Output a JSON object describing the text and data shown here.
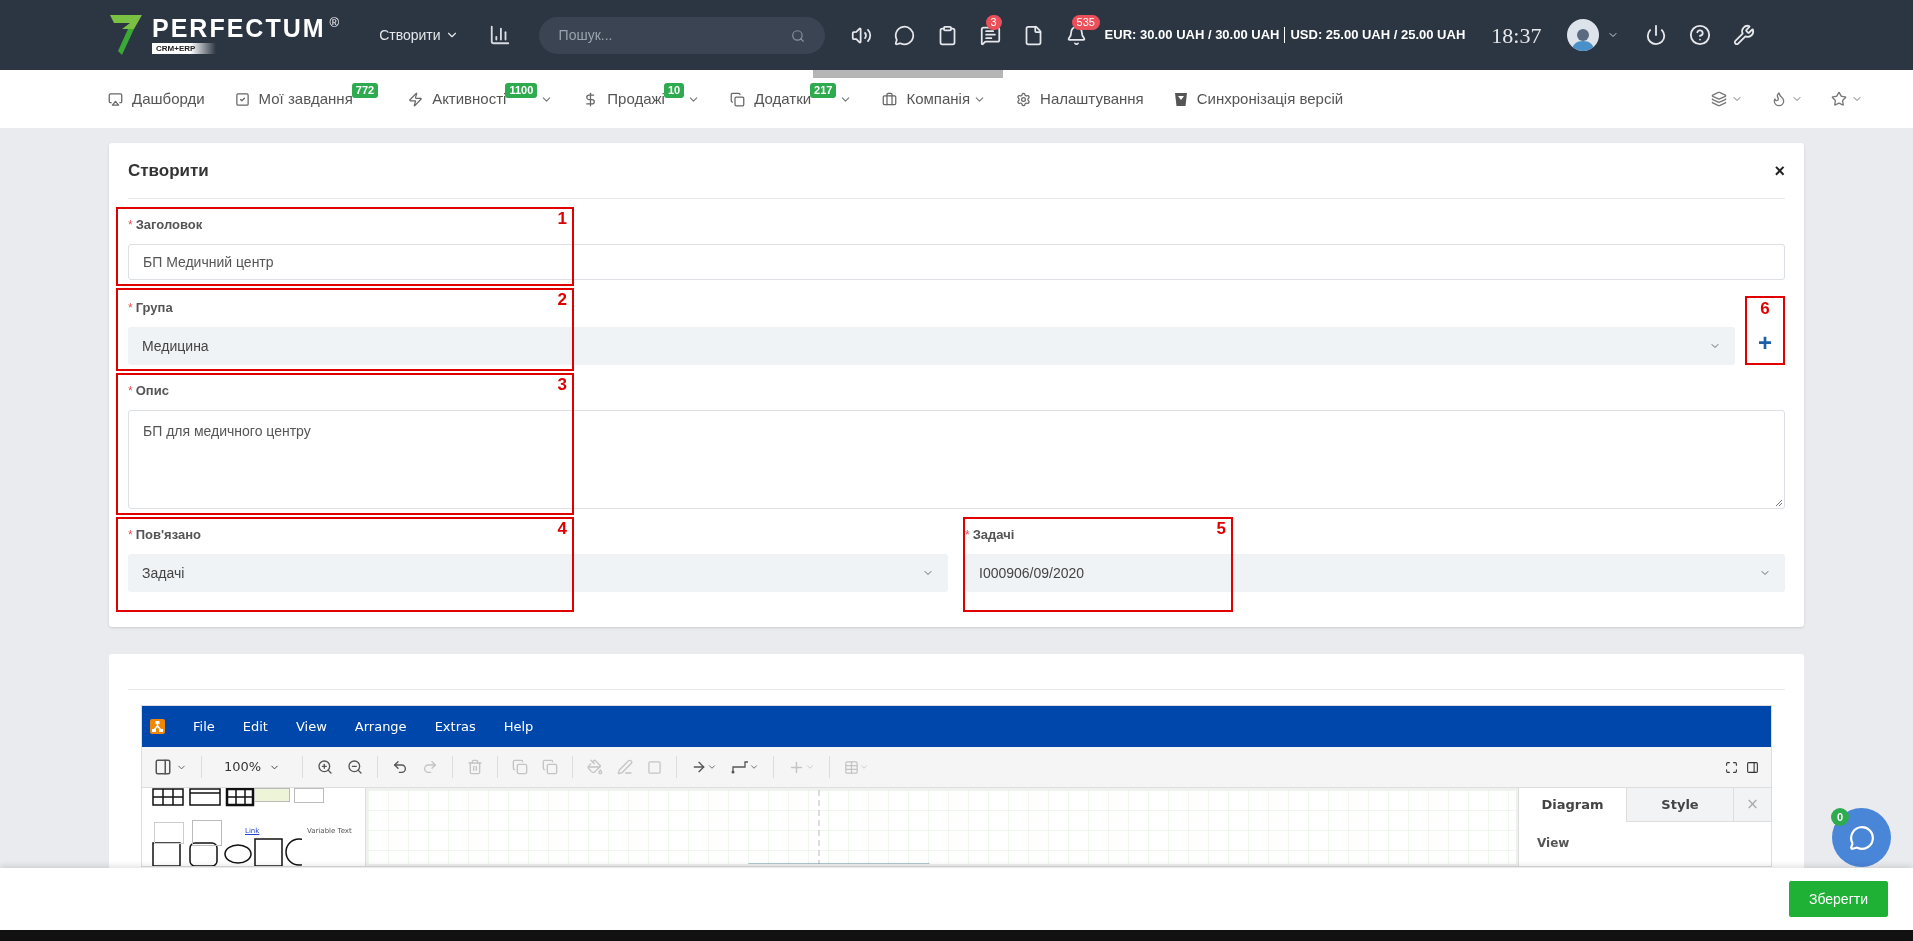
{
  "header": {
    "logo": "PERFECTUM",
    "logo_mark": "®",
    "logo_sub": "CRM+ERP",
    "create_menu": "Створити",
    "search": {
      "placeholder": "Пошук..."
    },
    "icons": [
      {
        "kind": "sound"
      },
      {
        "kind": "chat"
      },
      {
        "kind": "clipboard"
      },
      {
        "kind": "messages",
        "badge": "3"
      },
      {
        "kind": "document"
      },
      {
        "kind": "bell",
        "badge": "535"
      }
    ],
    "rates": [
      "EUR: 30.00 UAH / 30.00 UAH",
      "USD: 25.00 UAH / 25.00 UAH"
    ],
    "time": "18:37",
    "actions": [
      {
        "kind": "power"
      },
      {
        "kind": "help"
      },
      {
        "kind": "wrench"
      }
    ]
  },
  "nav": {
    "items": [
      {
        "kind": "dashboard",
        "label": "Дашборди",
        "has_menu": false
      },
      {
        "kind": "tasks",
        "label": "Мої завдання",
        "badge": "772",
        "has_menu": false
      },
      {
        "kind": "activity",
        "label": "Активності",
        "badge": "1100",
        "has_menu": true
      },
      {
        "kind": "sales",
        "label": "Продажі",
        "badge": "10",
        "has_menu": true
      },
      {
        "kind": "addons",
        "label": "Додатки",
        "badge": "217",
        "has_menu": true
      },
      {
        "kind": "company",
        "label": "Компанія",
        "has_menu": true
      },
      {
        "kind": "settings",
        "label": "Налаштування",
        "has_menu": false
      },
      {
        "kind": "sync",
        "label": "Синхронізація версій",
        "has_menu": false
      }
    ],
    "right_icons": [
      {
        "kind": "layers"
      },
      {
        "kind": "fire"
      },
      {
        "kind": "star"
      }
    ]
  },
  "form": {
    "title": "Створити",
    "close": "×",
    "rows": [
      [
        {
          "kind": "text",
          "label": "Заголовок",
          "required_mark": "*",
          "value": "БП Медичний центр",
          "annotation": "1"
        }
      ],
      [
        {
          "kind": "select",
          "label": "Група",
          "required_mark": "*",
          "value": "Медицина",
          "annotation": "2",
          "add_button": {
            "label": "+",
            "annotation": "6"
          }
        }
      ],
      [
        {
          "kind": "textarea",
          "label": "Опис",
          "required_mark": "*",
          "value": "БП для медичного центру",
          "annotation": "3"
        }
      ],
      [
        {
          "kind": "select",
          "label": "Пов'язано",
          "required_mark": "*",
          "value": "Задачі",
          "annotation": "4"
        },
        {
          "kind": "select",
          "label": "Задачі",
          "required_mark": "*",
          "value": "I000906/09/2020",
          "annotation": "5"
        }
      ]
    ]
  },
  "editor": {
    "menu": [
      "File",
      "Edit",
      "View",
      "Arrange",
      "Extras",
      "Help"
    ],
    "zoom": "100%",
    "palette_texts": [
      "Link",
      "Variable Text"
    ],
    "panel_tabs": [
      {
        "label": "Diagram",
        "selected": true
      },
      {
        "label": "Style",
        "selected": false
      }
    ],
    "panel_close": "×",
    "panel_heading": "View"
  },
  "footer": {
    "save": "Зберегти"
  },
  "chat": {
    "badge": "0"
  }
}
